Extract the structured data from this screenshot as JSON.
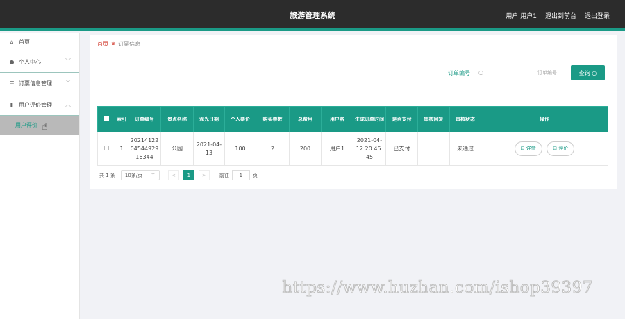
{
  "header": {
    "title": "旅游管理系统",
    "user": "用户 用户1",
    "back_label": "退出到前台",
    "logout_label": "退出登录"
  },
  "sidebar": {
    "items": [
      {
        "label": "首页",
        "icon": "home-icon"
      },
      {
        "label": "个人中心",
        "icon": "person-icon"
      },
      {
        "label": "订票信息管理",
        "icon": "sliders-icon"
      },
      {
        "label": "用户评价管理",
        "icon": "chart-icon"
      }
    ],
    "active_sub": "用户评价"
  },
  "breadcrumb": {
    "home": "首页",
    "current": "订票信息"
  },
  "search": {
    "label": "订单编号",
    "placeholder": "订单编号",
    "button": "查询"
  },
  "table": {
    "headers": [
      "索引",
      "订单编号",
      "景点名称",
      "观光日期",
      "个人票价",
      "购买票数",
      "总费用",
      "用户名",
      "生成订单时间",
      "是否支付",
      "审核回复",
      "审核状态",
      "操作"
    ],
    "rows": [
      {
        "index": "1",
        "order_no": "2021412204544929163 44",
        "order_no_lines": [
          "20214122",
          "04544929",
          "16344"
        ],
        "spot": "公园",
        "date_lines": [
          "2021-04-",
          "13"
        ],
        "price": "100",
        "count": "2",
        "total": "200",
        "user": "用户1",
        "time_lines": [
          "2021-04-",
          "12 20:45:",
          "45"
        ],
        "paid": "已支付",
        "reply": "",
        "status": "未通过",
        "detail_label": "详情",
        "review_label": "评价"
      }
    ]
  },
  "pager": {
    "total": "共 1 条",
    "page_size": "10条/页",
    "prev": "<",
    "page": "1",
    "next": ">",
    "goto_label": "前往",
    "goto_value": "1",
    "page_unit": "页"
  },
  "watermark": "https://www.huzhan.com/ishop39397",
  "colors": {
    "accent": "#1a9a86",
    "topbar": "#2c2c2c",
    "breadcrumb_home": "#d13b2e"
  }
}
